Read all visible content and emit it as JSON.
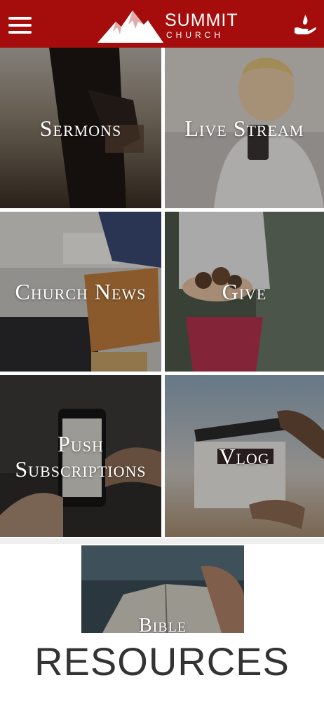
{
  "header": {
    "brand_line1": "SUMMIT",
    "brand_line2": "CHURCH",
    "menu_icon": "hamburger-menu-icon",
    "right_icon": "hand-flame-icon",
    "background_color": "#a50d0d"
  },
  "tiles": [
    {
      "label": "Sermons"
    },
    {
      "label": "Live Stream"
    },
    {
      "label": "Church News"
    },
    {
      "label": "Give"
    },
    {
      "label": "Push\nSubscriptions"
    },
    {
      "label": "Vlog"
    },
    {
      "label": "Bible"
    }
  ],
  "section": {
    "title": "RESOURCES"
  }
}
